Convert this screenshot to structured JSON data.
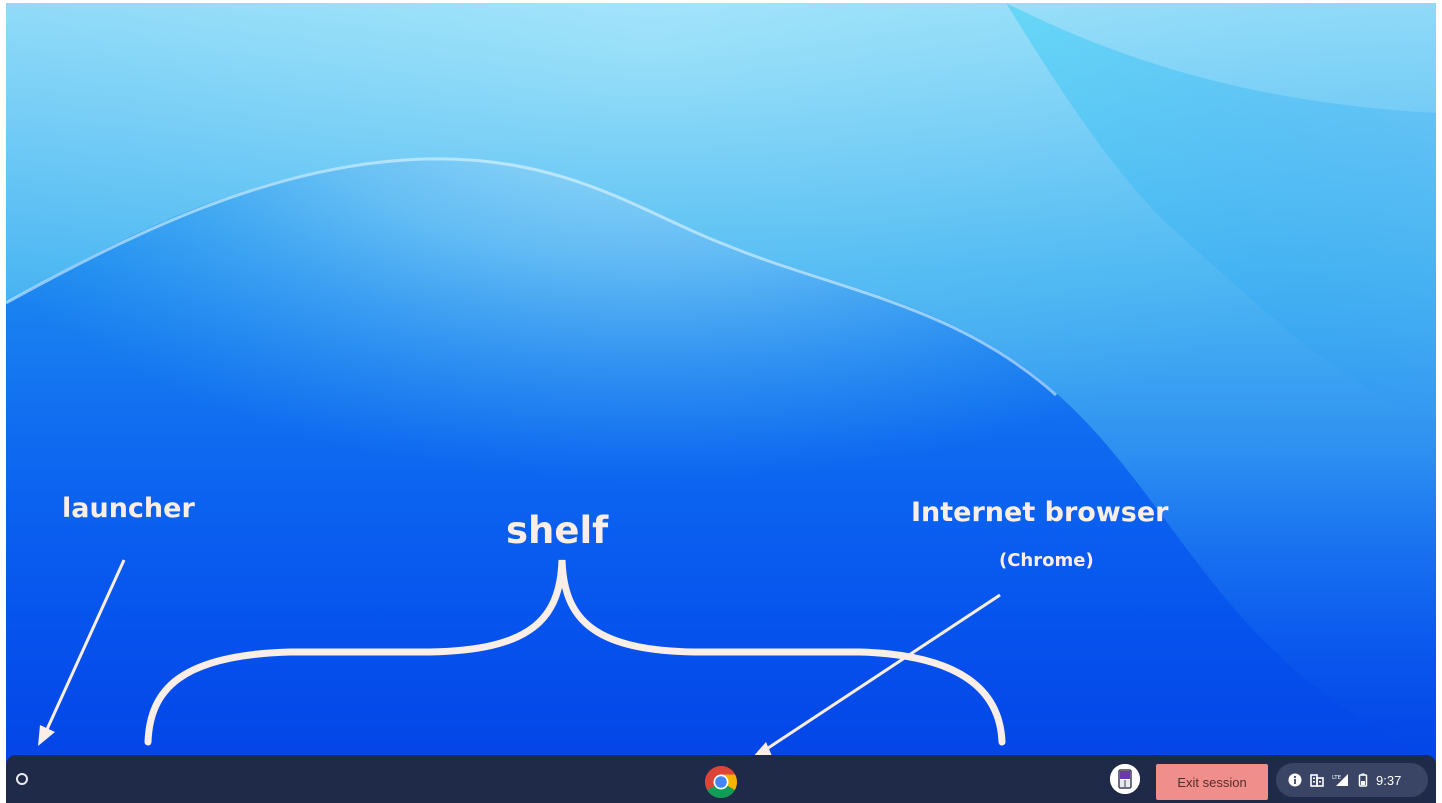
{
  "annotations": {
    "launcher": "launcher",
    "shelf": "shelf",
    "browser": "Internet browser",
    "browser_sub": "(Chrome)"
  },
  "shelf": {
    "launcher_icon": "launcher-circle-icon",
    "pinned_apps": [
      {
        "name": "Chrome",
        "icon": "chrome-icon"
      }
    ],
    "exit_session_label": "Exit session",
    "status_tray": {
      "icons": [
        "info-icon",
        "managed-device-icon",
        "lte-signal-icon",
        "battery-icon"
      ],
      "clock": "9:37"
    }
  },
  "colors": {
    "shelf_background": "#1f2a48",
    "exit_session_bg": "#ef8e8a",
    "annotation_text": "#fbeee6",
    "status_pill_bg": "#3a4565"
  }
}
